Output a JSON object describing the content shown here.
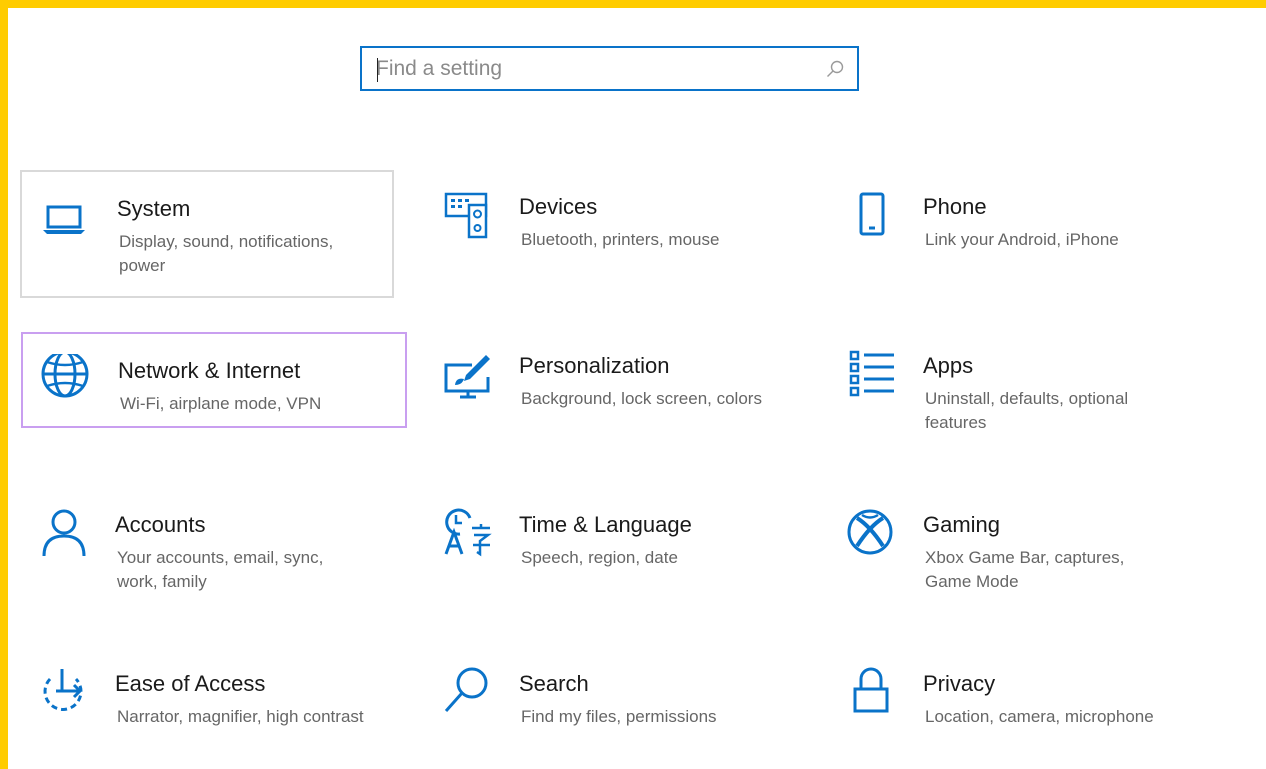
{
  "colors": {
    "accent": "#0a73c9",
    "frame": "#ffcc00",
    "hover_border": "#c99ff0",
    "focus_border": "#d9d9d9"
  },
  "search": {
    "placeholder": "Find a setting",
    "icon": "search-icon"
  },
  "tiles": [
    {
      "title": "System",
      "desc": "Display, sound, notifications, power",
      "icon": "laptop-icon",
      "state": "focused"
    },
    {
      "title": "Devices",
      "desc": "Bluetooth, printers, mouse",
      "icon": "keyboard-speaker-icon"
    },
    {
      "title": "Phone",
      "desc": "Link your Android, iPhone",
      "icon": "phone-icon"
    },
    {
      "title": "Network & Internet",
      "desc": "Wi-Fi, airplane mode, VPN",
      "icon": "globe-icon",
      "state": "hovered"
    },
    {
      "title": "Personalization",
      "desc": "Background, lock screen, colors",
      "icon": "paint-monitor-icon"
    },
    {
      "title": "Apps",
      "desc": "Uninstall, defaults, optional features",
      "icon": "app-list-icon"
    },
    {
      "title": "Accounts",
      "desc": "Your accounts, email, sync, work, family",
      "icon": "person-icon"
    },
    {
      "title": "Time & Language",
      "desc": "Speech, region, date",
      "icon": "time-language-icon"
    },
    {
      "title": "Gaming",
      "desc": "Xbox Game Bar, captures, Game Mode",
      "icon": "xbox-icon"
    },
    {
      "title": "Ease of Access",
      "desc": "Narrator, magnifier, high contrast",
      "icon": "ease-of-access-icon"
    },
    {
      "title": "Search",
      "desc": "Find my files, permissions",
      "icon": "magnifier-icon"
    },
    {
      "title": "Privacy",
      "desc": "Location, camera, microphone",
      "icon": "lock-icon"
    }
  ]
}
